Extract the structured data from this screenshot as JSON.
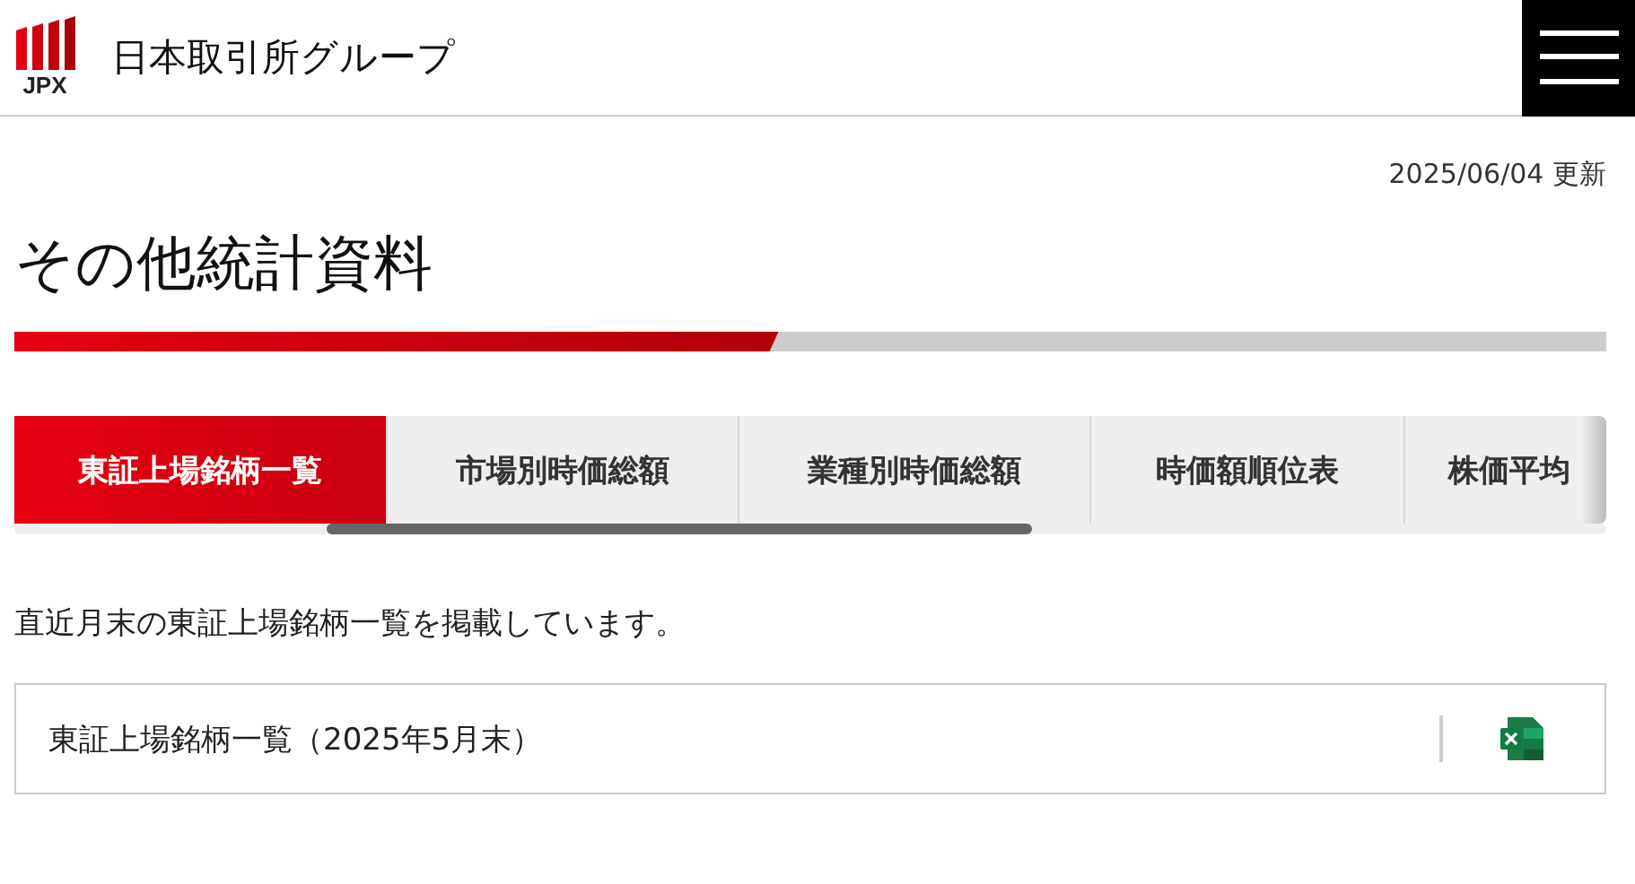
{
  "header": {
    "logo_text": "JPX",
    "site_name": "日本取引所グループ"
  },
  "updated": "2025/06/04 更新",
  "title": "その他統計資料",
  "progress": {
    "level": 0.48
  },
  "tabs": [
    {
      "label": "東証上場銘柄一覧",
      "selected": true
    },
    {
      "label": "市場別時価総額",
      "selected": false
    },
    {
      "label": "業種別時価総額",
      "selected": false
    },
    {
      "label": "時価額順位表",
      "selected": false
    },
    {
      "label": "株価平均",
      "selected": false
    }
  ],
  "description": "直近月末の東証上場銘柄一覧を掲載しています。",
  "files": [
    {
      "label": "東証上場銘柄一覧（2025年5月末）",
      "kind": "excel"
    }
  ]
}
